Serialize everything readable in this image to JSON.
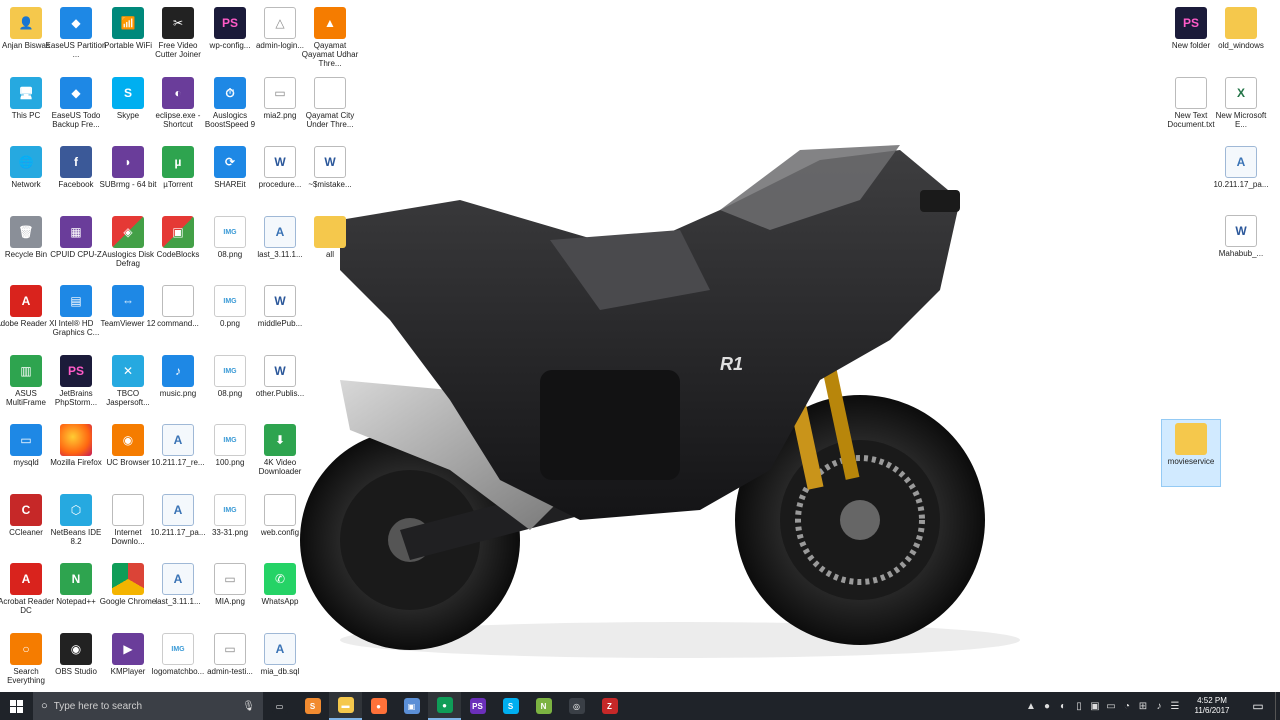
{
  "desktop": {
    "icons_left": [
      {
        "label": "Anjan Biswas",
        "icon": "user-folder-icon",
        "glyph": "👤",
        "style": "g-folder"
      },
      {
        "label": "EaseUS Partition ...",
        "icon": "easeus-partition-icon",
        "glyph": "◆",
        "style": "g-blue"
      },
      {
        "label": "Portable WiFi",
        "icon": "wifi-portable-icon",
        "glyph": "📶",
        "style": "g-teal"
      },
      {
        "label": "Free Video Cutter Joiner",
        "icon": "video-cutter-icon",
        "glyph": "✂",
        "style": "g-dark"
      },
      {
        "label": "wp-config...",
        "icon": "phpstorm-file-icon",
        "glyph": "PS",
        "style": "g-ps"
      },
      {
        "label": "admin-login...",
        "icon": "app-triangle-icon",
        "glyph": "△",
        "style": "g-doc"
      },
      {
        "label": "Qayamat Qayamat Udhar Thre...",
        "icon": "vlc-icon",
        "glyph": "▲",
        "style": "g-orange"
      },
      {
        "label": "This PC",
        "icon": "this-pc-icon",
        "glyph": "🖥",
        "style": "g-cyan"
      },
      {
        "label": "EaseUS Todo Backup Fre...",
        "icon": "easeus-todo-icon",
        "glyph": "◆",
        "style": "g-blue"
      },
      {
        "label": "Skype",
        "icon": "skype-icon",
        "glyph": "S",
        "style": "g-skype"
      },
      {
        "label": "eclipse.exe - Shortcut",
        "icon": "eclipse-icon",
        "glyph": "◐",
        "style": "g-purple"
      },
      {
        "label": "Auslogics BoostSpeed 9",
        "icon": "auslogics-boost-icon",
        "glyph": "⏱",
        "style": "g-blue"
      },
      {
        "label": "mia2.png",
        "icon": "image-file-icon",
        "glyph": "▭",
        "style": "g-doc"
      },
      {
        "label": "Qayamat City Under Thre...",
        "icon": "blank-file-icon",
        "glyph": "",
        "style": "g-doc"
      },
      {
        "label": "Network",
        "icon": "network-icon",
        "glyph": "🌐",
        "style": "g-cyan"
      },
      {
        "label": "Facebook",
        "icon": "facebook-icon",
        "glyph": "f",
        "style": "g-fb"
      },
      {
        "label": "SUBrmg - 64 bit",
        "icon": "dolphin-icon",
        "glyph": "◗",
        "style": "g-purple"
      },
      {
        "label": "µTorrent",
        "icon": "utorrent-icon",
        "glyph": "µ",
        "style": "g-green"
      },
      {
        "label": "SHAREit",
        "icon": "shareit-icon",
        "glyph": "⟳",
        "style": "g-blue"
      },
      {
        "label": "procedure...",
        "icon": "word-doc-icon",
        "glyph": "W",
        "style": "g-word"
      },
      {
        "label": "~$mistake...",
        "icon": "word-doc-icon",
        "glyph": "W",
        "style": "g-word"
      },
      {
        "label": "Recycle Bin",
        "icon": "recycle-bin-icon",
        "glyph": "🗑",
        "style": "g-grey"
      },
      {
        "label": "CPUID CPU-Z",
        "icon": "cpuz-icon",
        "glyph": "▦",
        "style": "g-purple"
      },
      {
        "label": "Auslogics Disk Defrag",
        "icon": "disk-defrag-icon",
        "glyph": "◈",
        "style": "g-multi"
      },
      {
        "label": "CodeBlocks",
        "icon": "codeblocks-icon",
        "glyph": "▣",
        "style": "g-multi"
      },
      {
        "label": "08.png",
        "icon": "image-file-icon",
        "glyph": "IMG",
        "style": "g-img"
      },
      {
        "label": "last_3.11.1...",
        "icon": "text-file-icon",
        "glyph": "A",
        "style": "g-txt"
      },
      {
        "label": "all",
        "icon": "folder-icon",
        "glyph": "",
        "style": "g-folder"
      },
      {
        "label": "Adobe Reader XI",
        "icon": "adobe-reader-icon",
        "glyph": "A",
        "style": "g-pdf"
      },
      {
        "label": "Intel® HD Graphics C...",
        "icon": "intel-graphics-icon",
        "glyph": "▤",
        "style": "g-blue"
      },
      {
        "label": "TeamViewer 12",
        "icon": "teamviewer-icon",
        "glyph": "⇔",
        "style": "g-blue"
      },
      {
        "label": "command...",
        "icon": "blank-file-icon",
        "glyph": "",
        "style": "g-doc"
      },
      {
        "label": "0.png",
        "icon": "image-file-icon",
        "glyph": "IMG",
        "style": "g-img"
      },
      {
        "label": "middlePub...",
        "icon": "word-doc-icon",
        "glyph": "W",
        "style": "g-word"
      },
      {
        "label": "ASUS MultiFrame",
        "icon": "asus-multiframe-icon",
        "glyph": "▥",
        "style": "g-green"
      },
      {
        "label": "JetBrains PhpStorm...",
        "icon": "phpstorm-icon",
        "glyph": "PS",
        "style": "g-ps"
      },
      {
        "label": "TBCO Jaspersoft...",
        "icon": "jaspersoft-icon",
        "glyph": "✕",
        "style": "g-cyan"
      },
      {
        "label": "music.png",
        "icon": "music-file-icon",
        "glyph": "♪",
        "style": "g-blue"
      },
      {
        "label": "08.png",
        "icon": "image-file-icon",
        "glyph": "IMG",
        "style": "g-img"
      },
      {
        "label": "other.Publis...",
        "icon": "word-doc-icon",
        "glyph": "W",
        "style": "g-word"
      },
      {
        "label": "mysqld",
        "icon": "mysql-window-icon",
        "glyph": "▭",
        "style": "g-blue"
      },
      {
        "label": "Mozilla Firefox",
        "icon": "firefox-icon",
        "glyph": "",
        "style": "g-firefox"
      },
      {
        "label": "UC Browser",
        "icon": "uc-browser-icon",
        "glyph": "◉",
        "style": "g-orange"
      },
      {
        "label": "10.211.17_re...",
        "icon": "text-file-icon",
        "glyph": "A",
        "style": "g-txt"
      },
      {
        "label": "100.png",
        "icon": "image-file-icon",
        "glyph": "IMG",
        "style": "g-img"
      },
      {
        "label": "4K Video Downloader",
        "icon": "video-downloader-icon",
        "glyph": "⬇",
        "style": "g-green"
      },
      {
        "label": "CCleaner",
        "icon": "ccleaner-icon",
        "glyph": "C",
        "style": "g-red"
      },
      {
        "label": "NetBeans IDE 8.2",
        "icon": "netbeans-icon",
        "glyph": "⬡",
        "style": "g-cyan"
      },
      {
        "label": "Internet Downlo...",
        "icon": "blank-file-icon",
        "glyph": "",
        "style": "g-doc"
      },
      {
        "label": "10.211.17_pa...",
        "icon": "text-file-icon",
        "glyph": "A",
        "style": "g-txt"
      },
      {
        "label": "33-31.png",
        "icon": "image-file-icon",
        "glyph": "IMG",
        "style": "g-img"
      },
      {
        "label": "web.config",
        "icon": "blank-file-icon",
        "glyph": "",
        "style": "g-doc"
      },
      {
        "label": "Acrobat Reader DC",
        "icon": "acrobat-icon",
        "glyph": "A",
        "style": "g-pdf"
      },
      {
        "label": "Notepad++",
        "icon": "notepad-plus-icon",
        "glyph": "N",
        "style": "g-green"
      },
      {
        "label": "Google Chrome",
        "icon": "chrome-icon",
        "glyph": "",
        "style": "g-chrome"
      },
      {
        "label": "last_3.11.1...",
        "icon": "text-file-icon",
        "glyph": "A",
        "style": "g-txt"
      },
      {
        "label": "MIA.png",
        "icon": "image-file-icon",
        "glyph": "▭",
        "style": "g-doc"
      },
      {
        "label": "WhatsApp",
        "icon": "whatsapp-icon",
        "glyph": "✆",
        "style": "g-whatsapp"
      },
      {
        "label": "Search Everything",
        "icon": "search-everything-icon",
        "glyph": "○",
        "style": "g-orange"
      },
      {
        "label": "OBS Studio",
        "icon": "obs-icon",
        "glyph": "◉",
        "style": "g-dark"
      },
      {
        "label": "KMPlayer",
        "icon": "kmplayer-icon",
        "glyph": "▶",
        "style": "g-purple"
      },
      {
        "label": "logomatchbo...",
        "icon": "image-file-icon",
        "glyph": "IMG",
        "style": "g-img"
      },
      {
        "label": "admin-testi...",
        "icon": "image-file-icon",
        "glyph": "▭",
        "style": "g-doc"
      },
      {
        "label": "mia_db.sql",
        "icon": "text-file-icon",
        "glyph": "A",
        "style": "g-txt"
      }
    ],
    "icons_right": [
      {
        "label": "New folder",
        "icon": "phpstorm-folder-icon",
        "glyph": "PS",
        "style": "g-ps"
      },
      {
        "label": "old_windows",
        "icon": "folder-icon",
        "glyph": "",
        "style": "g-folder"
      },
      {
        "label": "New Text Document.txt",
        "icon": "blank-file-icon",
        "glyph": "",
        "style": "g-doc"
      },
      {
        "label": "New Microsoft E...",
        "icon": "excel-file-icon",
        "glyph": "X",
        "style": "g-excel"
      },
      {
        "label": "10.211.17_pa...",
        "icon": "text-file-icon",
        "glyph": "A",
        "style": "g-txt"
      },
      {
        "label": "Mahabub_...",
        "icon": "word-doc-icon",
        "glyph": "W",
        "style": "g-word"
      },
      {
        "label": "movieservice",
        "icon": "zip-folder-icon",
        "glyph": "",
        "style": "g-folder"
      }
    ]
  },
  "taskbar": {
    "search_placeholder": "Type here to search",
    "apps": [
      {
        "name": "task-view-button",
        "glyph": "▭",
        "color": "#1f2329"
      },
      {
        "name": "taskbar-sublime-button",
        "glyph": "S",
        "color": "#f28b30"
      },
      {
        "name": "taskbar-file-explorer-button",
        "glyph": "▬",
        "color": "#f5c84c"
      },
      {
        "name": "taskbar-firefox-button",
        "glyph": "●",
        "color": "#ff7139"
      },
      {
        "name": "taskbar-virtualbox-button",
        "glyph": "▣",
        "color": "#5b8fd6"
      },
      {
        "name": "taskbar-chrome-button",
        "glyph": "●",
        "color": "#0f9d58"
      },
      {
        "name": "taskbar-phpstorm-button",
        "glyph": "PS",
        "color": "#6b2fba"
      },
      {
        "name": "taskbar-skype-button",
        "glyph": "S",
        "color": "#00aff0"
      },
      {
        "name": "taskbar-notepad-plus-button",
        "glyph": "N",
        "color": "#7cb342"
      },
      {
        "name": "taskbar-github-button",
        "glyph": "◎",
        "color": "#3a3f46"
      },
      {
        "name": "taskbar-filezilla-button",
        "glyph": "Z",
        "color": "#c62828"
      }
    ],
    "tray_icons": [
      "▲",
      "●",
      "◐",
      "▯",
      "▣",
      "▭",
      "◔",
      "⊞",
      "♪",
      "☰"
    ],
    "clock_time": "4:52 PM",
    "clock_date": "11/6/2017"
  },
  "colors": {
    "taskbar": "#1f2329",
    "search_box": "#3b3f46",
    "active_indicator": "#7fb4e8"
  }
}
